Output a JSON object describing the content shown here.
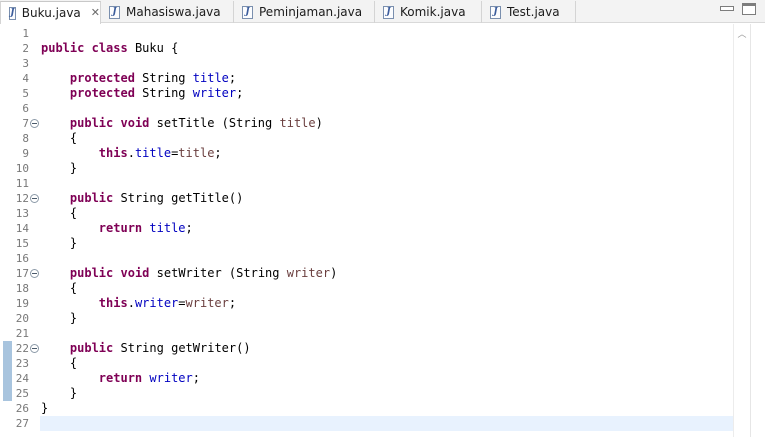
{
  "tabs": [
    {
      "label": "Buku.java",
      "active": true,
      "closable": true
    },
    {
      "label": "Mahasiswa.java",
      "active": false
    },
    {
      "label": "Peminjaman.java",
      "active": false
    },
    {
      "label": "Komik.java",
      "active": false
    },
    {
      "label": "Test.java",
      "active": false
    }
  ],
  "editor": {
    "current_line": 27,
    "fold_lines": [
      7,
      12,
      17,
      22
    ],
    "occurrence_marked_lines": [
      22,
      23,
      24,
      25
    ],
    "lines": [
      {
        "n": "1",
        "code": ""
      },
      {
        "n": "2",
        "code": "public class Buku {"
      },
      {
        "n": "3",
        "code": ""
      },
      {
        "n": "4",
        "code": "    protected String title;"
      },
      {
        "n": "5",
        "code": "    protected String writer;"
      },
      {
        "n": "6",
        "code": ""
      },
      {
        "n": "7",
        "code": "    public void setTitle (String title)"
      },
      {
        "n": "8",
        "code": "    {"
      },
      {
        "n": "9",
        "code": "        this.title=title;"
      },
      {
        "n": "10",
        "code": "    }"
      },
      {
        "n": "11",
        "code": ""
      },
      {
        "n": "12",
        "code": "    public String getTitle()"
      },
      {
        "n": "13",
        "code": "    {"
      },
      {
        "n": "14",
        "code": "        return title;"
      },
      {
        "n": "15",
        "code": "    }"
      },
      {
        "n": "16",
        "code": ""
      },
      {
        "n": "17",
        "code": "    public void setWriter (String writer)"
      },
      {
        "n": "18",
        "code": "    {"
      },
      {
        "n": "19",
        "code": "        this.writer=writer;"
      },
      {
        "n": "20",
        "code": "    }"
      },
      {
        "n": "21",
        "code": ""
      },
      {
        "n": "22",
        "code": "    public String getWriter()"
      },
      {
        "n": "23",
        "code": "    {"
      },
      {
        "n": "24",
        "code": "        return writer;"
      },
      {
        "n": "25",
        "code": "    }"
      },
      {
        "n": "26",
        "code": "}"
      },
      {
        "n": "27",
        "code": ""
      }
    ]
  },
  "colors": {
    "keyword": "#7f0055",
    "field": "#0000c0",
    "parameter": "#6a3e3e",
    "current_line_bg": "#e8f2fe"
  },
  "icons": {
    "java_file": "java-file-icon",
    "close": "close-icon",
    "minimize": "minimize-icon",
    "maximize": "maximize-icon",
    "fold": "fold-collapse-icon",
    "scroll_up": "scroll-up-icon"
  }
}
